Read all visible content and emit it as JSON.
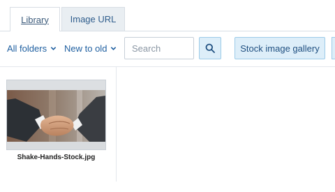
{
  "tabs": {
    "library_label": "Library",
    "image_url_label": "Image URL"
  },
  "toolbar": {
    "folder_filter": "All folders",
    "sort_order": "New to old",
    "search_placeholder": "Search",
    "search_value": "",
    "stock_gallery_label": "Stock image gallery"
  },
  "library": {
    "items": [
      {
        "filename": "Shake-Hands-Stock.jpg",
        "icon": "handshake-image"
      }
    ]
  },
  "colors": {
    "accent": "#1f5fa0",
    "button_bg": "#ddeef9",
    "button_border": "#9ccbe8"
  }
}
